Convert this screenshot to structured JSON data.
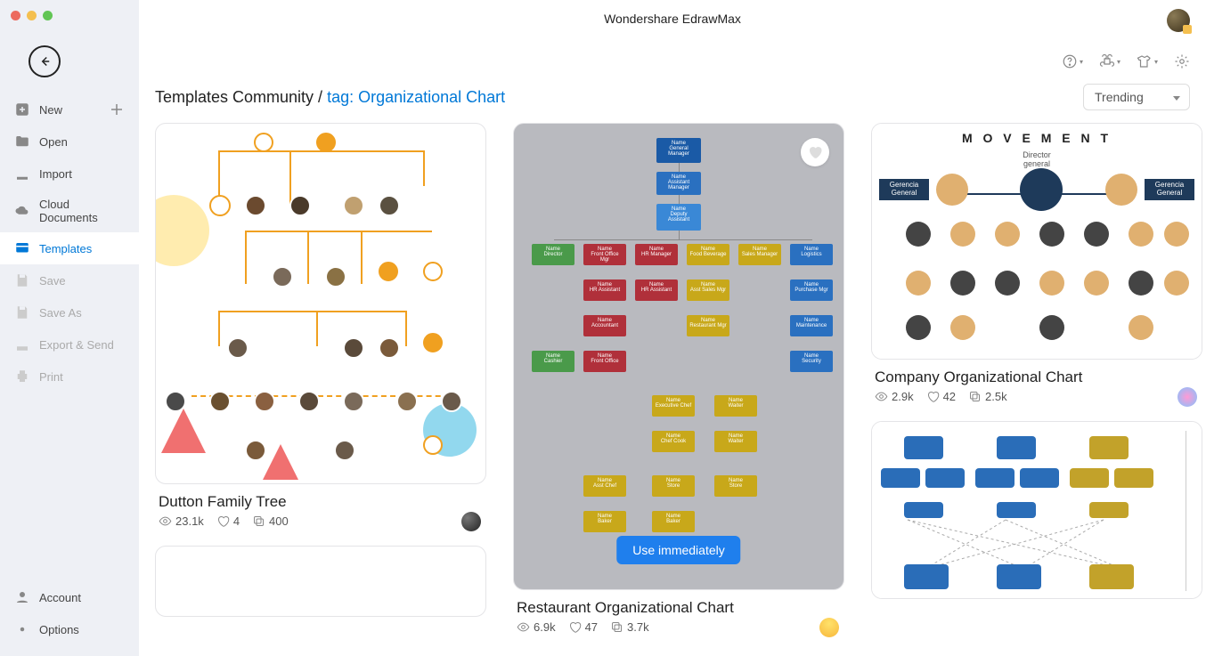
{
  "app_title": "Wondershare EdrawMax",
  "breadcrumb_root": "Templates Community / ",
  "breadcrumb_tag": "tag: Organizational Chart",
  "sort_label": "Trending",
  "sidebar": {
    "new": "New",
    "open": "Open",
    "import": "Import",
    "cloud": "Cloud Documents",
    "templates": "Templates",
    "save": "Save",
    "saveas": "Save As",
    "export": "Export & Send",
    "print": "Print",
    "account": "Account",
    "options": "Options"
  },
  "cards": {
    "a": {
      "title": "Dutton Family Tree",
      "views": "23.1k",
      "likes": "4",
      "copies": "400"
    },
    "b": {
      "title": "Restaurant Organizational Chart",
      "views": "6.9k",
      "likes": "47",
      "copies": "3.7k",
      "use_label": "Use immediately"
    },
    "c": {
      "title": "Company Organizational Chart",
      "views": "2.9k",
      "likes": "42",
      "copies": "2.5k",
      "header": "M O V E M E N T",
      "sub": "Director\ngeneral",
      "side": "Gerencia General"
    }
  }
}
